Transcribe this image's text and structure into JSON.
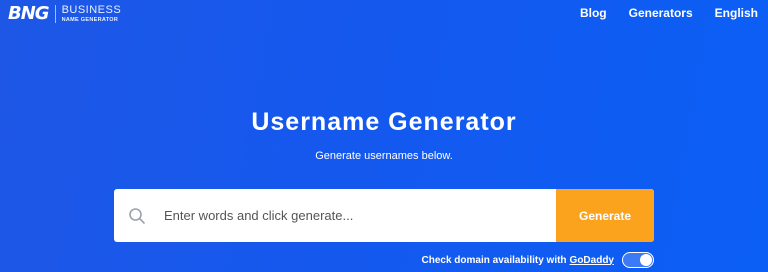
{
  "header": {
    "logo_mark": "BNG",
    "logo_line1": "BUSINESS",
    "logo_line2": "NAME GENERATOR",
    "nav": [
      "Blog",
      "Generators",
      "English"
    ]
  },
  "main": {
    "title": "Username Generator",
    "subtitle": "Generate usernames below."
  },
  "search": {
    "placeholder": "Enter words and click generate...",
    "value": "",
    "button_label": "Generate",
    "search_icon": "search-icon"
  },
  "domain_check": {
    "label": "Check domain availability with",
    "provider": "GoDaddy",
    "enabled": true
  },
  "colors": {
    "background": "#1558ee",
    "button": "#fba31c",
    "text": "#ffffff"
  }
}
